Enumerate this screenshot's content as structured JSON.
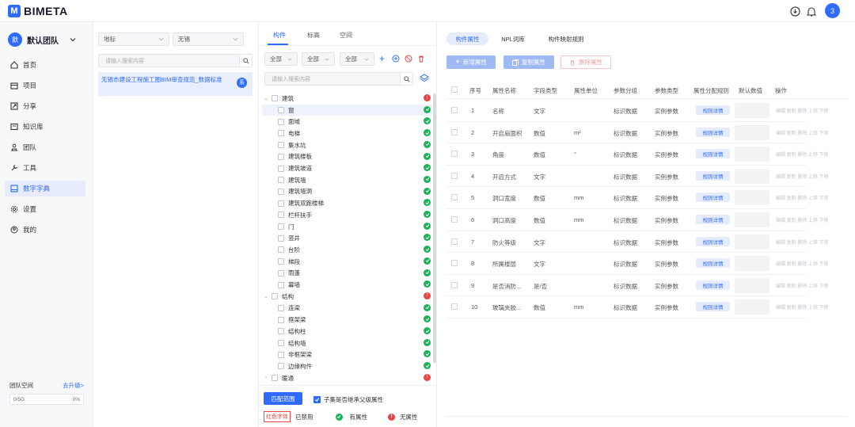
{
  "app": {
    "logo_mark": "M",
    "logo_text": "BIMETA",
    "notif_count": "3"
  },
  "nav": {
    "team_avatar": "默",
    "team_name": "默认团队",
    "items": [
      {
        "label": "首页",
        "icon": "home-icon"
      },
      {
        "label": "项目",
        "icon": "project-icon"
      },
      {
        "label": "分享",
        "icon": "share-icon"
      },
      {
        "label": "知识库",
        "icon": "knowledge-icon"
      },
      {
        "label": "团队",
        "icon": "team-icon"
      },
      {
        "label": "工具",
        "icon": "tool-icon"
      },
      {
        "label": "数字字典",
        "icon": "dictionary-icon",
        "active": true
      },
      {
        "label": "设置",
        "icon": "settings-icon"
      },
      {
        "label": "我的",
        "icon": "profile-icon"
      }
    ],
    "space_label": "团队空间",
    "upgrade_label": "去升级>",
    "space_used": "0/5G",
    "space_percent": "0%"
  },
  "standards": {
    "filter1": "地标",
    "filter2": "无锡",
    "search_placeholder": "请输入搜索内容",
    "item_title": "无锡市建设工程施工图BIM审查规范_数据标准",
    "item_badge": "系"
  },
  "components": {
    "tabs": [
      "构件",
      "标高",
      "空间"
    ],
    "filters": [
      "全部",
      "全部",
      "全部"
    ],
    "search_placeholder": "请输入搜索内容",
    "tree": [
      {
        "label": "建筑",
        "level": 0,
        "status": "no"
      },
      {
        "label": "窗",
        "level": 1,
        "status": "ok",
        "selected": true
      },
      {
        "label": "面域",
        "level": 1,
        "status": "ok"
      },
      {
        "label": "电梯",
        "level": 1,
        "status": "ok"
      },
      {
        "label": "集水坑",
        "level": 1,
        "status": "ok"
      },
      {
        "label": "建筑楼板",
        "level": 1,
        "status": "ok"
      },
      {
        "label": "建筑坡道",
        "level": 1,
        "status": "ok"
      },
      {
        "label": "建筑墙",
        "level": 1,
        "status": "ok"
      },
      {
        "label": "建筑墙洞",
        "level": 1,
        "status": "ok"
      },
      {
        "label": "建筑双跑楼梯",
        "level": 1,
        "status": "ok"
      },
      {
        "label": "栏杆扶手",
        "level": 1,
        "status": "ok"
      },
      {
        "label": "门",
        "level": 1,
        "status": "ok"
      },
      {
        "label": "竖井",
        "level": 1,
        "status": "ok"
      },
      {
        "label": "台阶",
        "level": 1,
        "status": "ok"
      },
      {
        "label": "梯段",
        "level": 1,
        "status": "ok"
      },
      {
        "label": "雨蓬",
        "level": 1,
        "status": "ok"
      },
      {
        "label": "幕墙",
        "level": 1,
        "status": "ok"
      },
      {
        "label": "结构",
        "level": 0,
        "status": "no"
      },
      {
        "label": "连梁",
        "level": 1,
        "status": "ok"
      },
      {
        "label": "框架梁",
        "level": 1,
        "status": "ok"
      },
      {
        "label": "结构柱",
        "level": 1,
        "status": "ok"
      },
      {
        "label": "结构墙",
        "level": 1,
        "status": "ok"
      },
      {
        "label": "非框架梁",
        "level": 1,
        "status": "ok"
      },
      {
        "label": "边缘构件",
        "level": 1,
        "status": "ok"
      },
      {
        "label": "暖通",
        "level": 0,
        "status": "no",
        "collapsed": true
      }
    ],
    "match_btn": "匹配范围",
    "inherit_label": "子集是否继承父级属性",
    "legend_red": "红色字体",
    "legend_red_desc": "已禁用",
    "legend_ok": "有属性",
    "legend_no": "无属性"
  },
  "attributes": {
    "tabs": [
      "构件属性",
      "NPL词库",
      "构件映射规则"
    ],
    "add_btn": "新增属性",
    "copy_btn": "复制属性",
    "delete_btn": "删除属性",
    "headers": [
      "序号",
      "属性名称",
      "字段类型",
      "属性单位",
      "参数分组",
      "参数类型",
      "属性分配规则",
      "默认数值",
      "操作"
    ],
    "rows": [
      {
        "no": "1",
        "name": "名称",
        "type": "文字",
        "unit": "",
        "group": "标识数据",
        "ptype": "实例参数"
      },
      {
        "no": "2",
        "name": "开启扇面积",
        "type": "数值",
        "unit": "m²",
        "group": "标识数据",
        "ptype": "实例参数"
      },
      {
        "no": "3",
        "name": "角度",
        "type": "数值",
        "unit": "°",
        "group": "标识数据",
        "ptype": "实例参数"
      },
      {
        "no": "4",
        "name": "开启方式",
        "type": "文字",
        "unit": "",
        "group": "标识数据",
        "ptype": "实例参数"
      },
      {
        "no": "5",
        "name": "洞口宽度",
        "type": "数值",
        "unit": "mm",
        "group": "标识数据",
        "ptype": "实例参数"
      },
      {
        "no": "6",
        "name": "洞口高度",
        "type": "数值",
        "unit": "mm",
        "group": "标识数据",
        "ptype": "实例参数"
      },
      {
        "no": "7",
        "name": "防火等级",
        "type": "文字",
        "unit": "",
        "group": "标识数据",
        "ptype": "实例参数"
      },
      {
        "no": "8",
        "name": "所属楼层",
        "type": "文字",
        "unit": "",
        "group": "标识数据",
        "ptype": "实例参数"
      },
      {
        "no": "9",
        "name": "是否消防...",
        "type": "是/否",
        "unit": "",
        "group": "标识数据",
        "ptype": "实例参数"
      },
      {
        "no": "10",
        "name": "玻璃夹胶...",
        "type": "数值",
        "unit": "mm",
        "group": "标识数据",
        "ptype": "实例参数"
      }
    ],
    "rule_btn": "规则详情",
    "ops_text": "编辑 复制 删除 上移 下移"
  },
  "colors": {
    "accent": "#2f6bff",
    "ok": "#19b35a",
    "no": "#e84646"
  }
}
